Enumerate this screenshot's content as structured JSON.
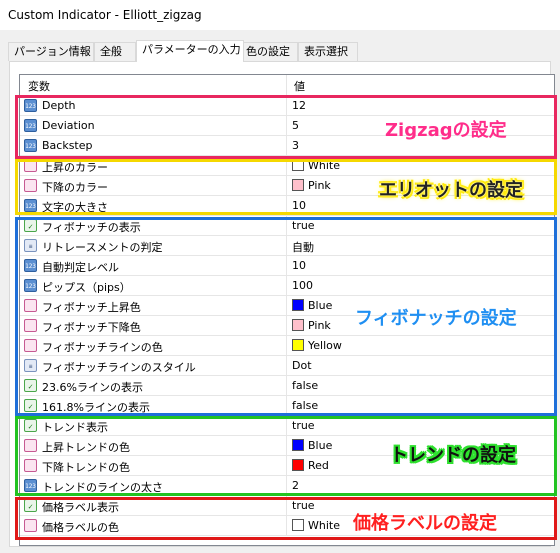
{
  "window": {
    "title": "Custom Indicator - Elliott_zigzag"
  },
  "tabs": [
    {
      "label": "パージョン情報"
    },
    {
      "label": "全般"
    },
    {
      "label": "パラメーターの入力"
    },
    {
      "label": "色の設定"
    },
    {
      "label": "表示選択"
    }
  ],
  "grid": {
    "col_variable": "変数",
    "col_value": "値",
    "rows": [
      {
        "type": "int",
        "name": "Depth",
        "value": "12"
      },
      {
        "type": "int",
        "name": "Deviation",
        "value": "5"
      },
      {
        "type": "int",
        "name": "Backstep",
        "value": "3"
      },
      {
        "type": "color",
        "name": "上昇のカラー",
        "value": "White",
        "swatch": "#ffffff"
      },
      {
        "type": "color",
        "name": "下降のカラー",
        "value": "Pink",
        "swatch": "#ffc0cb"
      },
      {
        "type": "int",
        "name": "文字の大きさ",
        "value": "10"
      },
      {
        "type": "bool",
        "name": "フィボナッチの表示",
        "value": "true"
      },
      {
        "type": "enum",
        "name": "リトレースメントの判定",
        "value": "自動"
      },
      {
        "type": "int",
        "name": "自動判定レベル",
        "value": "10"
      },
      {
        "type": "int",
        "name": "ピップス（pips）",
        "value": "100"
      },
      {
        "type": "color",
        "name": "フィボナッチ上昇色",
        "value": "Blue",
        "swatch": "#0000ff"
      },
      {
        "type": "color",
        "name": "フィボナッチ下降色",
        "value": "Pink",
        "swatch": "#ffc0cb"
      },
      {
        "type": "color",
        "name": "フィボナッチラインの色",
        "value": "Yellow",
        "swatch": "#ffff00"
      },
      {
        "type": "enum",
        "name": "フィボナッチラインのスタイル",
        "value": "Dot"
      },
      {
        "type": "bool",
        "name": "23.6%ラインの表示",
        "value": "false"
      },
      {
        "type": "bool",
        "name": "161.8%ラインの表示",
        "value": "false"
      },
      {
        "type": "bool",
        "name": "トレンド表示",
        "value": "true"
      },
      {
        "type": "color",
        "name": "上昇トレンドの色",
        "value": "Blue",
        "swatch": "#0000ff"
      },
      {
        "type": "color",
        "name": "下降トレンドの色",
        "value": "Red",
        "swatch": "#ff0000"
      },
      {
        "type": "int",
        "name": "トレンドのラインの太さ",
        "value": "2"
      },
      {
        "type": "bool",
        "name": "価格ラベル表示",
        "value": "true"
      },
      {
        "type": "color",
        "name": "価格ラベルの色",
        "value": "White",
        "swatch": "#ffffff"
      }
    ]
  },
  "annotations": {
    "zigzag": {
      "label": "Zigzagの設定",
      "color": "#e8275f"
    },
    "elliott": {
      "label": "エリオットの設定",
      "color": "#f5d800"
    },
    "fibonacci": {
      "label": "フィボナッチの設定",
      "color": "#1e6fd9"
    },
    "trend": {
      "label": "トレンドの設定",
      "color": "#22c322"
    },
    "price": {
      "label": "価格ラベルの設定",
      "color": "#e01818"
    }
  }
}
